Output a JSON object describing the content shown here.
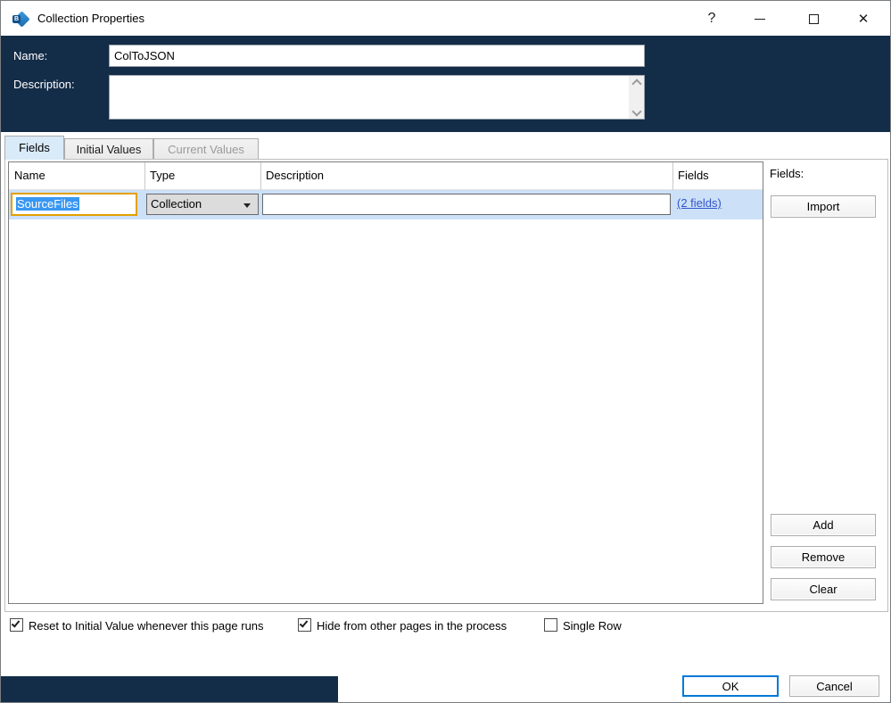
{
  "window": {
    "title": "Collection Properties",
    "help_glyph": "?",
    "close_glyph": "✕",
    "icon_letter": "B"
  },
  "header": {
    "name_label": "Name:",
    "name_value": "ColToJSON",
    "description_label": "Description:",
    "description_value": ""
  },
  "tabs": [
    {
      "label": "Fields",
      "state": "active"
    },
    {
      "label": "Initial Values",
      "state": "normal"
    },
    {
      "label": "Current Values",
      "state": "disabled"
    }
  ],
  "table": {
    "columns": [
      "Name",
      "Type",
      "Description",
      "Fields"
    ],
    "rows": [
      {
        "name": "SourceFiles",
        "type": "Collection",
        "description": "",
        "fields_link": "(2 fields)"
      }
    ]
  },
  "side_panel": {
    "fields_label": "Fields:",
    "import_label": "Import",
    "add_label": "Add",
    "remove_label": "Remove",
    "clear_label": "Clear"
  },
  "checkboxes": [
    {
      "label": "Reset to Initial Value whenever this page runs",
      "checked": true
    },
    {
      "label": "Hide from other pages in the process",
      "checked": true
    },
    {
      "label": "Single Row",
      "checked": false
    }
  ],
  "footer": {
    "ok_label": "OK",
    "cancel_label": "Cancel"
  },
  "colors": {
    "navy": "#132C48",
    "row_selected": "#CCE0F8",
    "link_blue": "#3355CC",
    "focus_orange": "#E2A000",
    "ok_border_blue": "#0078D7",
    "text_selection_blue": "#3897F3"
  }
}
